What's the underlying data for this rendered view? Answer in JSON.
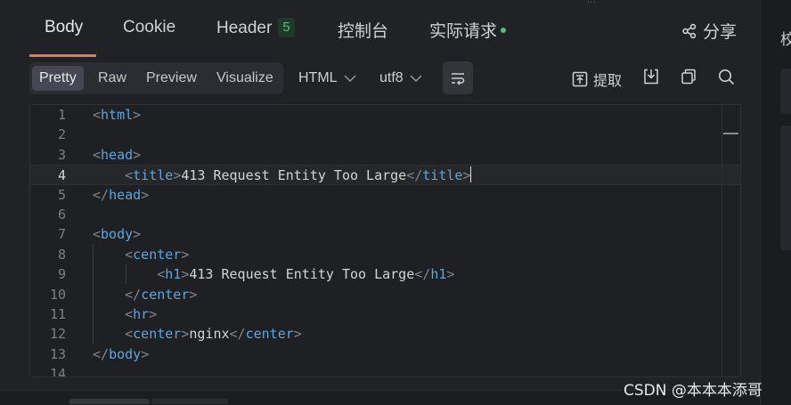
{
  "tabs": [
    {
      "label": "Body",
      "active": true
    },
    {
      "label": "Cookie"
    },
    {
      "label": "Header",
      "badge": "5"
    },
    {
      "label": "控制台"
    },
    {
      "label": "实际请求",
      "dot": true
    }
  ],
  "share_label": "分享",
  "toolbar": {
    "view_modes": [
      "Pretty",
      "Raw",
      "Preview",
      "Visualize"
    ],
    "active_mode": "Pretty",
    "format_select": "HTML",
    "encoding_select": "utf8",
    "extract_label": "提取"
  },
  "editor": {
    "current_line": 4,
    "lines": [
      {
        "n": "1"
      },
      {
        "n": "2"
      },
      {
        "n": "3"
      },
      {
        "n": "4"
      },
      {
        "n": "5"
      },
      {
        "n": "6"
      },
      {
        "n": "7"
      },
      {
        "n": "8"
      },
      {
        "n": "9"
      },
      {
        "n": "10"
      },
      {
        "n": "11"
      },
      {
        "n": "12"
      },
      {
        "n": "13"
      },
      {
        "n": "14"
      }
    ],
    "tags": {
      "html": "html",
      "head": "head",
      "title": "title",
      "body": "body",
      "center": "center",
      "h1": "h1",
      "hr": "hr"
    },
    "title_text": "413 Request Entity Too Large",
    "h1_text": "413 Request Entity Too Large",
    "footer_text": "nginx"
  },
  "right_panel": {
    "label": "校"
  },
  "watermark": "CSDN @本本本添哥",
  "colors": {
    "accent": "#e07b4f",
    "badge_green": "#4cc46b",
    "tag_blue": "#5aa6e0"
  }
}
